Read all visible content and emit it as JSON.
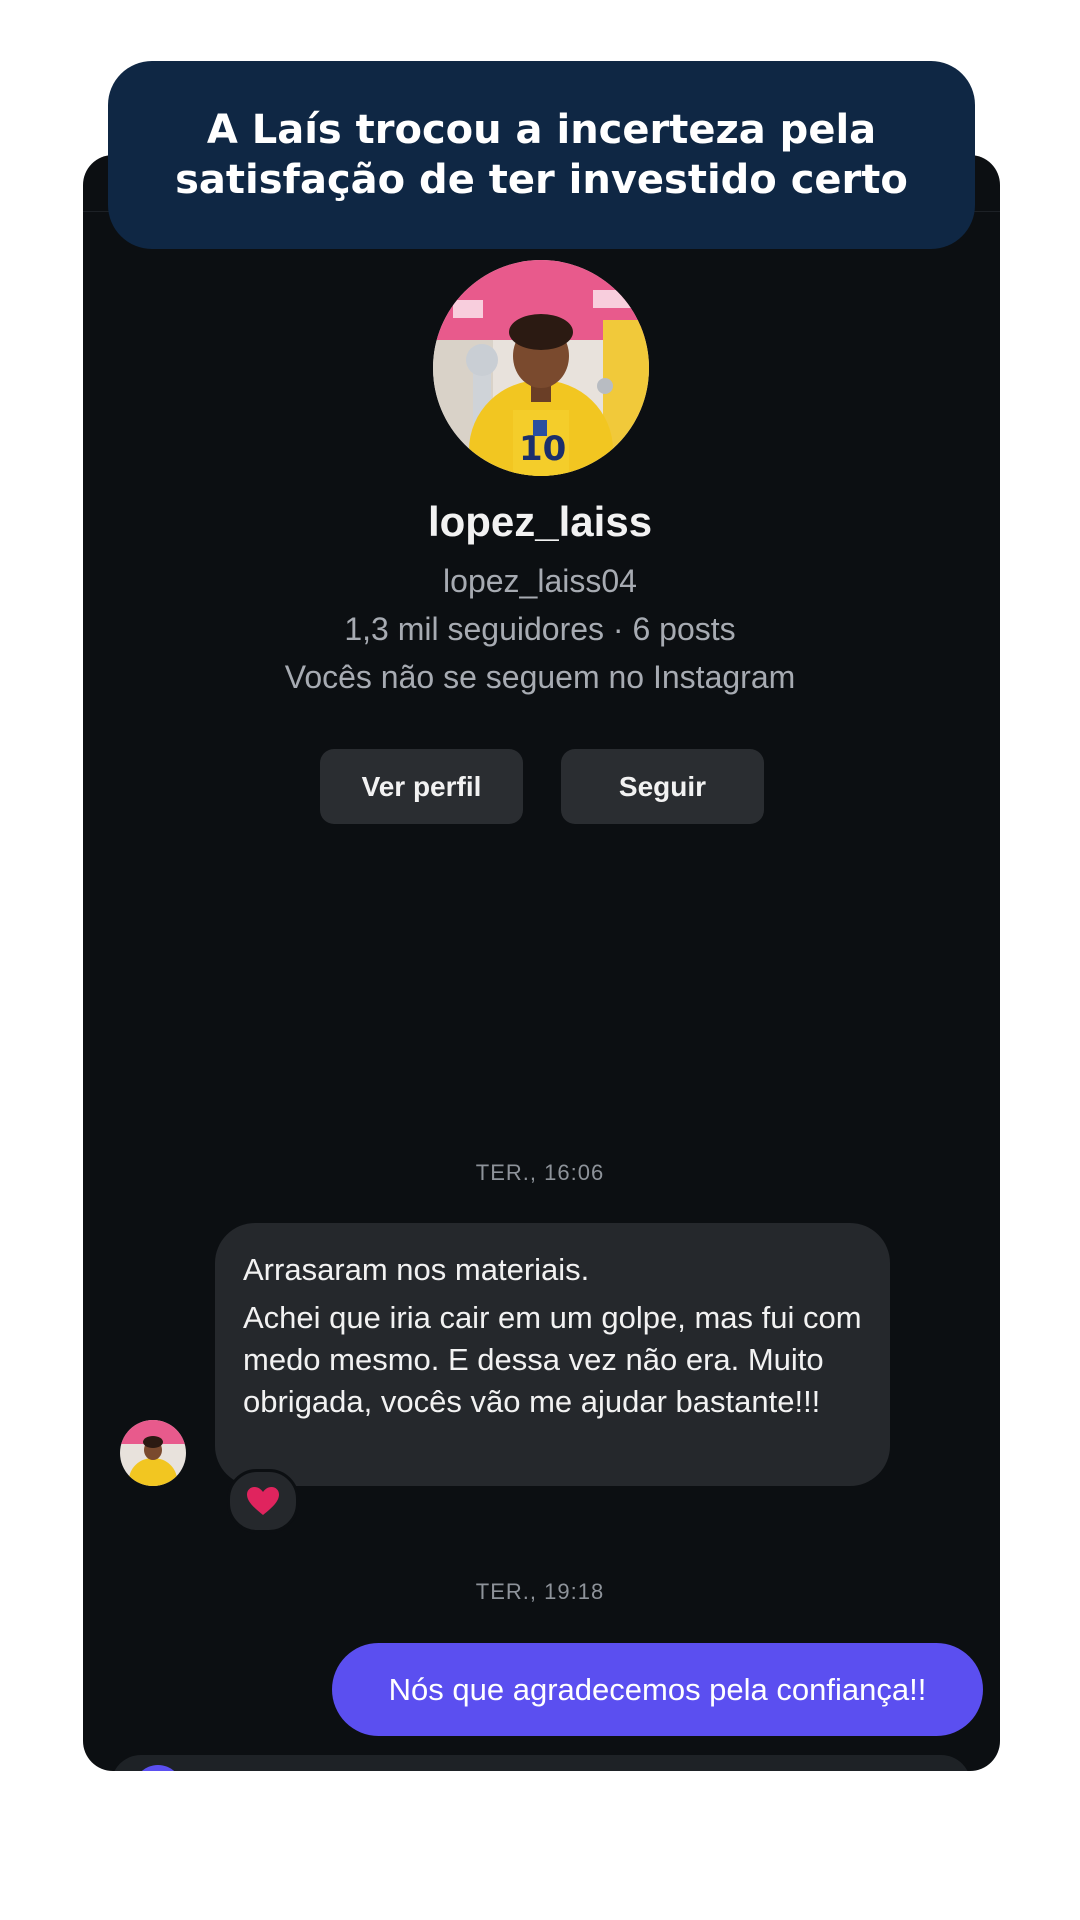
{
  "headline": "A Laís trocou a incerteza pela satisfação de ter investido certo",
  "profile": {
    "display_name": "lopez_laiss",
    "username": "lopez_laiss04",
    "stats": "1,3 mil seguidores · 6 posts",
    "relation": "Vocês não se seguem no Instagram",
    "buttons": {
      "view_profile": "Ver perfil",
      "follow": "Seguir"
    }
  },
  "messages": [
    {
      "timestamp": "TER., 16:06",
      "direction": "incoming",
      "lines": [
        "Arrasaram nos materiais.",
        "Achei que iria cair em um golpe, mas fui com medo mesmo. E dessa vez não era. Muito obrigada, vocês vão me ajudar bastante!!!"
      ],
      "reaction": "heart-icon"
    },
    {
      "timestamp": "TER., 19:18",
      "direction": "outgoing",
      "text": "Nós que agradecemos pela confiança!!"
    }
  ],
  "colors": {
    "banner_bg": "#0f2744",
    "chat_bg": "#0c0f12",
    "incoming_bubble": "#25282c",
    "outgoing_bubble": "#5b4ff0",
    "reaction_heart": "#e0245e"
  }
}
